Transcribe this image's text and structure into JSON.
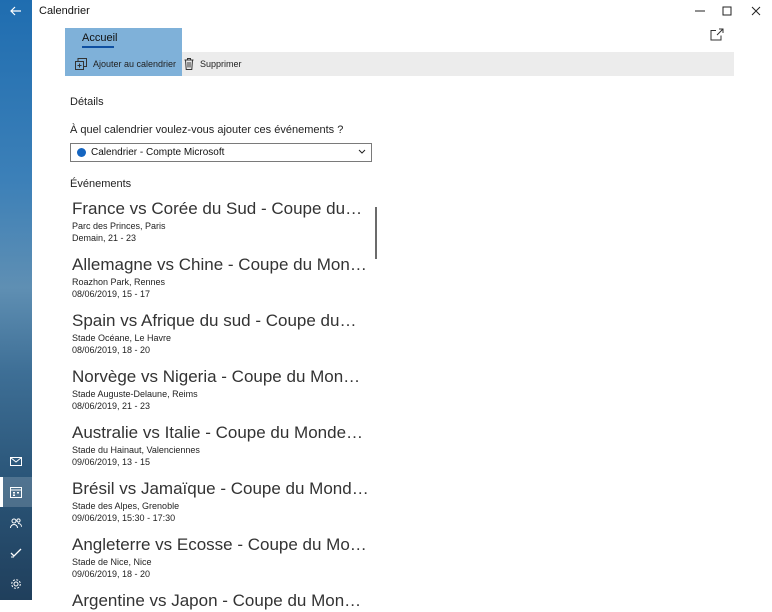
{
  "window": {
    "title": "Calendrier"
  },
  "ribbon": {
    "tab_label": "Accueil",
    "add_label": "Ajouter au calendrier",
    "delete_label": "Supprimer"
  },
  "details": {
    "section_label": "Détails",
    "question": "À quel calendrier voulez-vous ajouter ces événements ?",
    "calendar_selected": "Calendrier - Compte Microsoft",
    "calendar_color": "#1565c0"
  },
  "events_label": "Événements",
  "events": [
    {
      "title": "France vs Corée du Sud - Coupe du…",
      "venue": "Parc des Princes, Paris",
      "time": "Demain, 21 - 23"
    },
    {
      "title": "Allemagne vs Chine - Coupe du Mon…",
      "venue": "Roazhon Park, Rennes",
      "time": "08/06/2019, 15 - 17"
    },
    {
      "title": "Spain vs Afrique du sud - Coupe du…",
      "venue": "Stade Océane, Le Havre",
      "time": "08/06/2019, 18 - 20"
    },
    {
      "title": "Norvège vs Nigeria - Coupe du Mon…",
      "venue": "Stade Auguste-Delaune, Reims",
      "time": "08/06/2019, 21 - 23"
    },
    {
      "title": "Australie vs Italie - Coupe du Monde…",
      "venue": "Stade du Hainaut, Valenciennes",
      "time": "09/06/2019, 13 - 15"
    },
    {
      "title": "Brésil vs Jamaïque - Coupe du Mond…",
      "venue": "Stade des Alpes, Grenoble",
      "time": "09/06/2019, 15:30 - 17:30"
    },
    {
      "title": "Angleterre vs Ecosse - Coupe du Mo…",
      "venue": "Stade de Nice, Nice",
      "time": "09/06/2019, 18 - 20"
    },
    {
      "title": "Argentine vs Japon - Coupe du Mon…",
      "venue": "",
      "time": ""
    }
  ],
  "icons": {
    "back": "back-arrow-icon",
    "mail": "mail-icon",
    "calendar": "calendar-icon",
    "people": "people-icon",
    "todo": "todo-icon",
    "settings": "gear-icon"
  },
  "colors": {
    "accent": "#7fb1d9",
    "rail_top": "#1f6db0"
  }
}
